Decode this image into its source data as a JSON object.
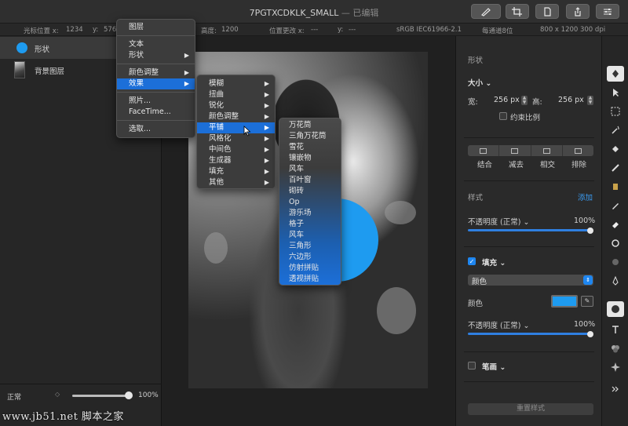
{
  "window": {
    "title": "7PGTXCDKLK_SMALL",
    "title_sep": " — ",
    "title_status": "已编辑"
  },
  "infobar": {
    "cursor_pos_label": "光标位置 x:",
    "cursor_x": "1234",
    "cursor_y_label": "y:",
    "cursor_y": "576",
    "height_label": "高度:",
    "height": "1200",
    "pos_change_label": "位置更改 x:",
    "pos_change_x": "---",
    "pos_change_y_label": "y:",
    "pos_change_y": "---",
    "color_profile": "sRGB IEC61966-2.1",
    "channel_depth": "每通道8位",
    "doc_size": "800 x 1200 300 dpi"
  },
  "layers": {
    "items": [
      {
        "label": "形状",
        "selected": true
      },
      {
        "label": "背景图层",
        "selected": false
      }
    ],
    "blend_mode": "正常",
    "blend_arrows": "◇",
    "opacity_value": 1.0,
    "opacity_label": "100%"
  },
  "watermark": "www.jb51.net 脚本之家",
  "context_menu": {
    "items": [
      {
        "label": "图层",
        "submenu": false
      },
      {
        "label": "文本",
        "submenu": false
      },
      {
        "label": "形状",
        "submenu": true
      },
      {
        "label": "颜色调整",
        "submenu": true
      },
      {
        "label": "效果",
        "submenu": true,
        "highlighted": true
      },
      {
        "label": "照片...",
        "submenu": false
      },
      {
        "label": "FaceTime...",
        "submenu": false
      },
      {
        "label": "选取...",
        "submenu": false
      }
    ]
  },
  "effects_menu": {
    "items": [
      {
        "label": "模糊",
        "submenu": true
      },
      {
        "label": "扭曲",
        "submenu": true
      },
      {
        "label": "锐化",
        "submenu": true
      },
      {
        "label": "颜色调整",
        "submenu": true
      },
      {
        "label": "平铺",
        "submenu": true,
        "highlighted": true
      },
      {
        "label": "风格化",
        "submenu": true
      },
      {
        "label": "中间色",
        "submenu": true
      },
      {
        "label": "生成器",
        "submenu": true
      },
      {
        "label": "填充",
        "submenu": true
      },
      {
        "label": "其他",
        "submenu": true
      }
    ]
  },
  "tile_menu": {
    "items": [
      "万花筒",
      "三角万花筒",
      "雪花",
      "镶嵌物",
      "风车",
      "百叶窗",
      "砌砖",
      "Op",
      "游乐场",
      "格子",
      "风车",
      "三角形",
      "六边形",
      "仿射拼贴",
      "透视拼贴"
    ]
  },
  "properties": {
    "section_shape": "形状",
    "size_label": "大小",
    "width_label": "宽:",
    "width_value": "256 px",
    "height_label": "高:",
    "height_value": "256 px",
    "constrain_label": "约束比例",
    "constrain_checked": false,
    "bool_ops": [
      "结合",
      "减去",
      "相交",
      "排除"
    ],
    "style_label": "样式",
    "add_label": "添加",
    "opacity1_label": "不透明度 (正常)",
    "opacity1_value": 1.0,
    "opacity1_pct": "100%",
    "fill_label": "填充",
    "fill_checked": true,
    "fill_type": "颜色",
    "color_label": "颜色",
    "fill_color": "#1e9bf0",
    "opacity2_label": "不透明度 (正常)",
    "opacity2_value": 1.0,
    "opacity2_pct": "100%",
    "stroke_label": "笔画",
    "stroke_checked": false,
    "reset_label": "重置样式"
  },
  "tools": [
    "arrange-icon",
    "pointer-icon",
    "marquee-icon",
    "magic-wand-icon",
    "paint-bucket-icon",
    "brush-icon",
    "gradient-fill-icon",
    "pencil-icon",
    "eraser-icon",
    "clone-icon",
    "blur-icon",
    "pen-icon",
    "shape-icon",
    "text-icon",
    "color-adjust-icon",
    "effects-icon",
    "more-icon"
  ],
  "colors": {
    "accent": "#1c6fd8",
    "shape_blue": "#1e9bf0"
  }
}
